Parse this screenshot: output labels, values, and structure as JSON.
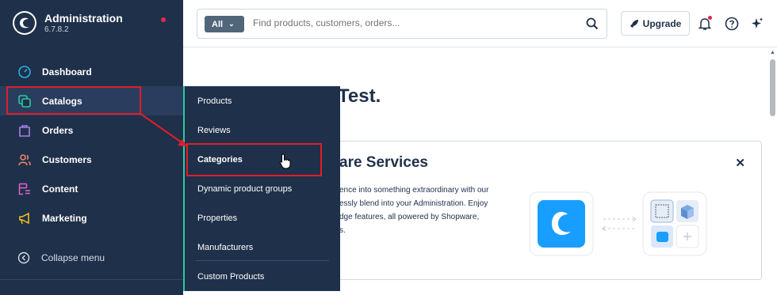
{
  "sidebar": {
    "brand_title": "Administration",
    "brand_version": "6.7.8.2",
    "items": [
      {
        "label": "Dashboard",
        "icon": "dashboard-icon",
        "color": "#2bb0e8"
      },
      {
        "label": "Catalogs",
        "icon": "catalog-icon",
        "color": "#2cc9a0"
      },
      {
        "label": "Orders",
        "icon": "orders-icon",
        "color": "#a87ee6"
      },
      {
        "label": "Customers",
        "icon": "customers-icon",
        "color": "#f18a6b"
      },
      {
        "label": "Content",
        "icon": "content-icon",
        "color": "#e462c6"
      },
      {
        "label": "Marketing",
        "icon": "marketing-icon",
        "color": "#f5c518"
      }
    ],
    "collapse_label": "Collapse menu"
  },
  "topbar": {
    "search_filter": "All",
    "search_placeholder": "Find products, customers, orders...",
    "upgrade_label": "Upgrade"
  },
  "main": {
    "welcome_text": "Test.",
    "card": {
      "title": "are Services",
      "text_lines": [
        "ence into something extraordinary with our",
        "essly blend into your Administration. Enjoy",
        "dge features, all powered by Shopware,",
        "s."
      ]
    }
  },
  "flyout": {
    "items": [
      "Products",
      "Reviews",
      "Categories",
      "Dynamic product groups",
      "Properties",
      "Manufacturers",
      "Custom Products"
    ]
  },
  "colors": {
    "sidebar_bg": "#1f304a",
    "accent_green": "#2cc9a0",
    "highlight_red": "#e01e2a",
    "brand_blue": "#189eff"
  }
}
